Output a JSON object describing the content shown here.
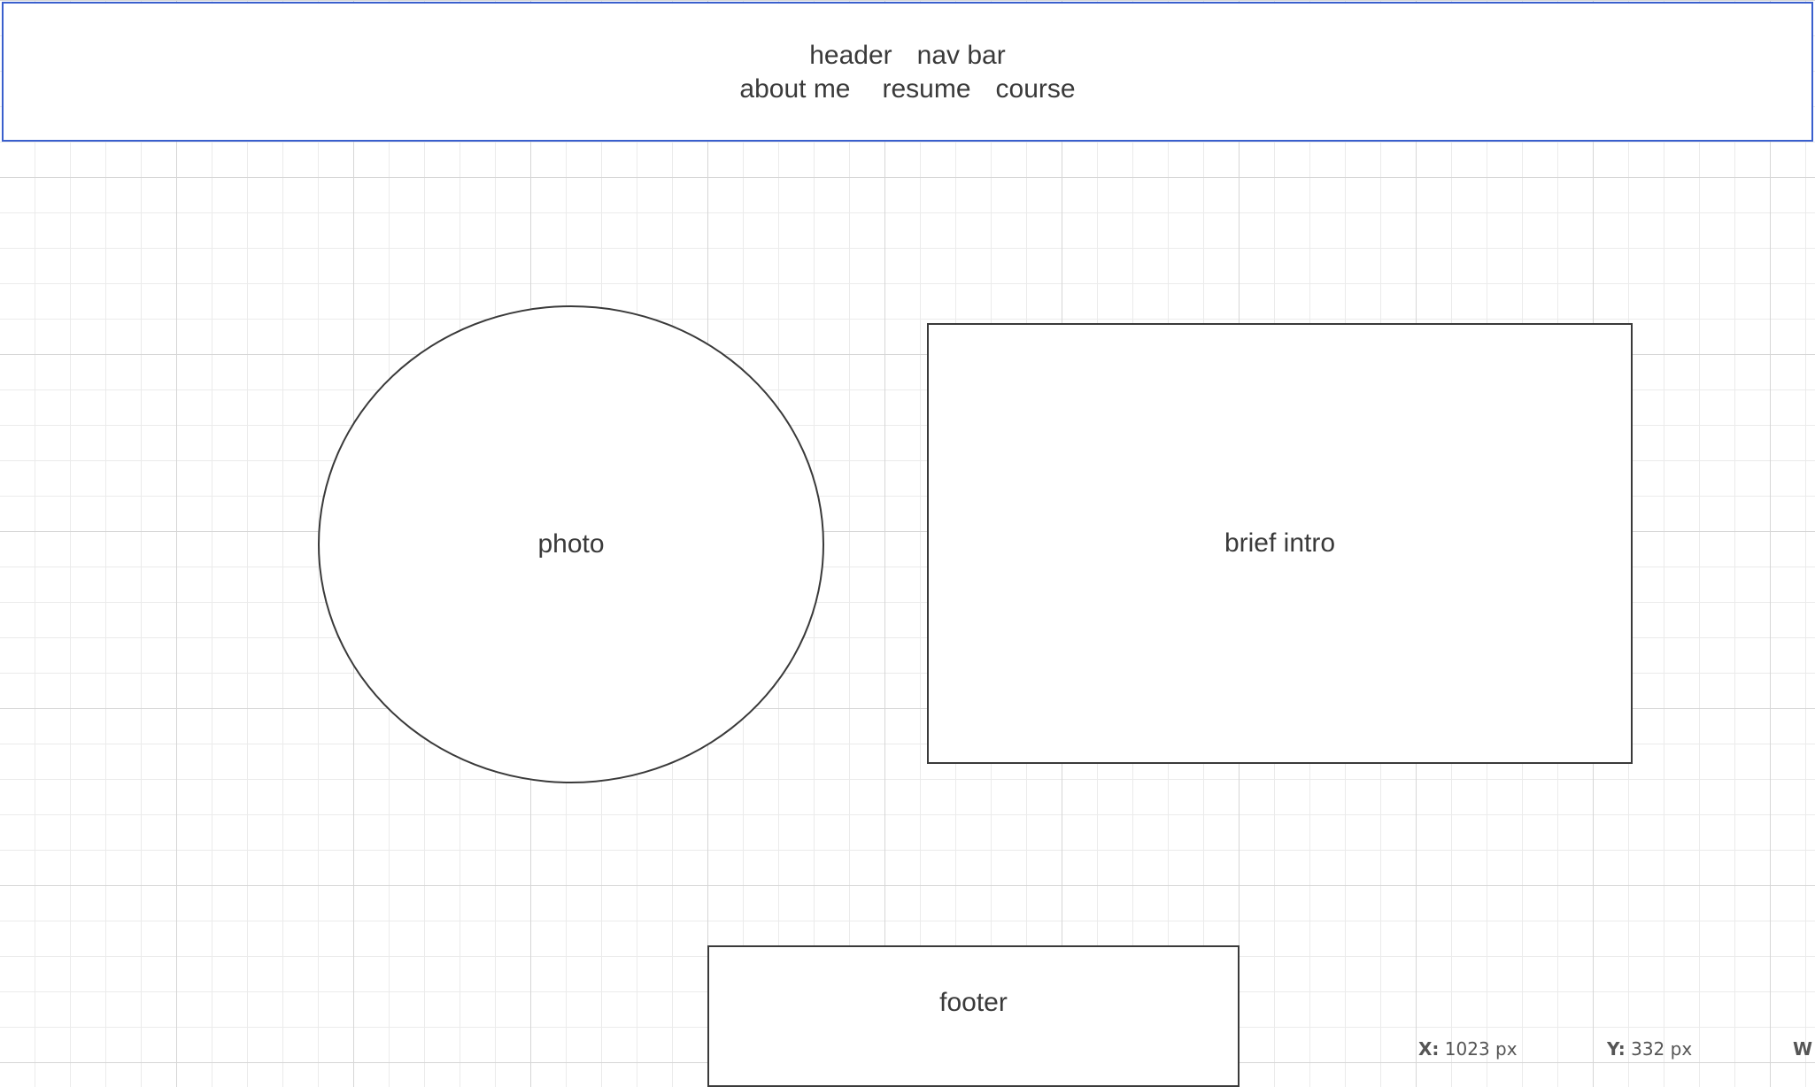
{
  "canvas": {
    "grid": "on",
    "colors": {
      "header_border": "#3a5fcd",
      "shape_border": "#3a3a3a",
      "text": "#3a3a3a",
      "grid_major": "#d6d6d6",
      "grid_minor": "#ebebeb"
    }
  },
  "header": {
    "line1": [
      "header",
      "nav bar"
    ],
    "line2": [
      "about me",
      "resume",
      "course"
    ]
  },
  "photo": {
    "label": "photo"
  },
  "intro": {
    "label": "brief intro"
  },
  "footer": {
    "label": "footer"
  },
  "status": {
    "x_label": "X:",
    "x_value": "1023 px",
    "y_label": "Y:",
    "y_value": "332 px",
    "w_label": "W"
  }
}
